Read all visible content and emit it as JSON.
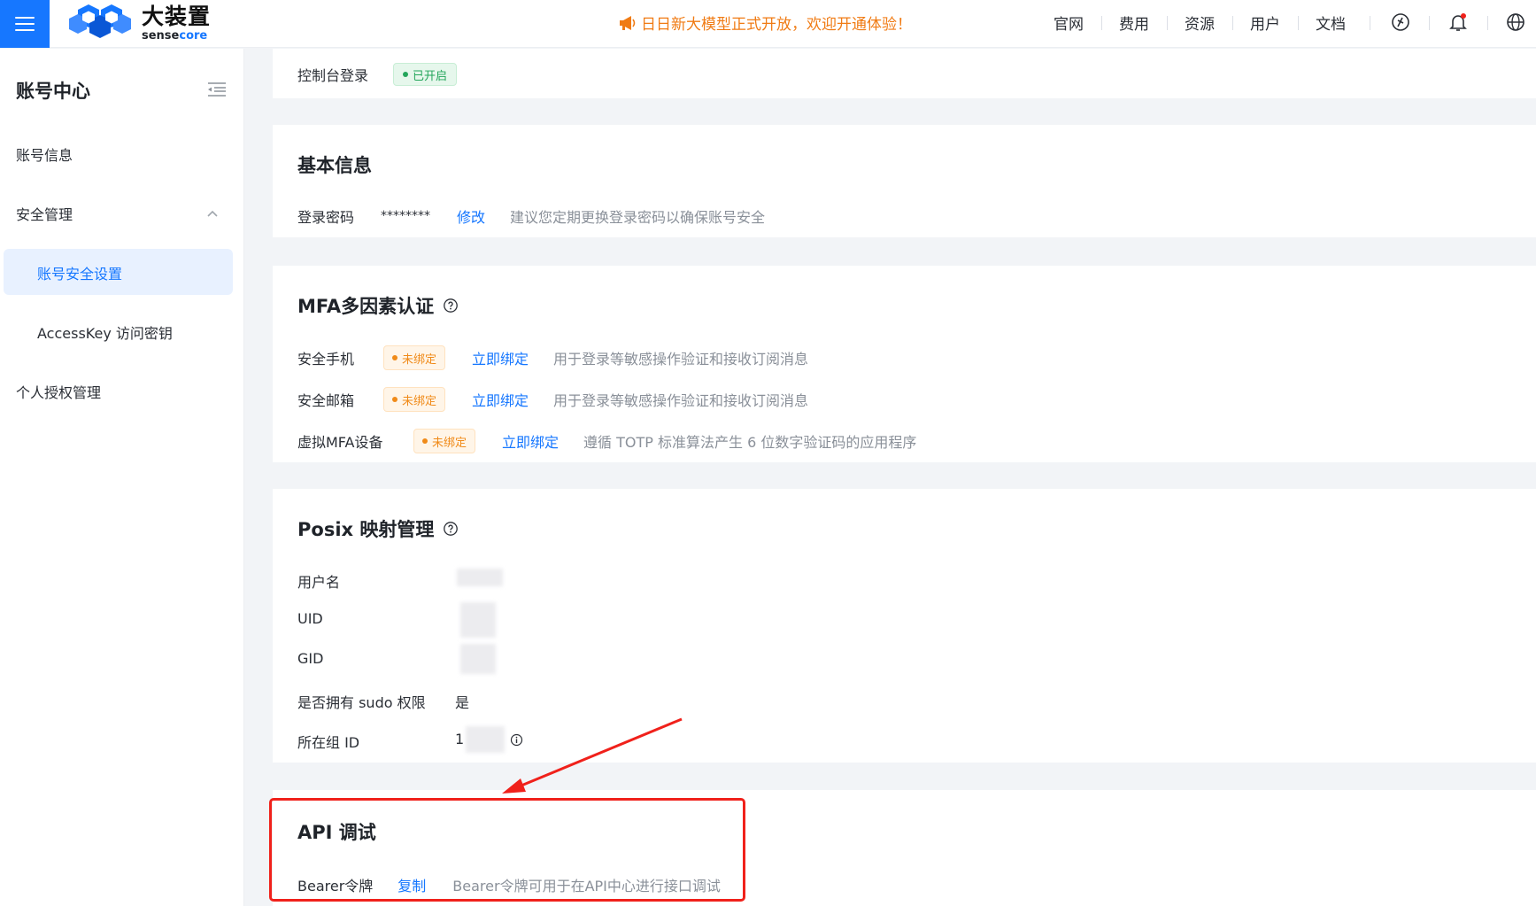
{
  "header": {
    "brand_cn": "大装置",
    "brand_en_prefix": "sense",
    "brand_en_suffix": "core",
    "announcement": "日日新大模型正式开放，欢迎开通体验！",
    "nav": [
      "官网",
      "费用",
      "资源",
      "用户",
      "文档"
    ],
    "icons": [
      "menu-icon",
      "megaphone-icon",
      "ai-assistant-icon",
      "bell-icon",
      "globe-icon"
    ],
    "accent": "#1677ff",
    "announcement_color": "#f07b14"
  },
  "sidebar": {
    "title": "账号中心",
    "items": [
      {
        "label": "账号信息"
      },
      {
        "label": "安全管理",
        "expanded": true
      },
      {
        "label": "账号安全设置",
        "active": true
      },
      {
        "label": "AccessKey 访问密钥"
      },
      {
        "label": "个人授权管理"
      }
    ]
  },
  "login_card": {
    "label": "控制台登录",
    "status": "已开启",
    "status_color": "#23a55a"
  },
  "basic_info": {
    "title": "基本信息",
    "password_label": "登录密码",
    "password_value": "********",
    "edit_link": "修改",
    "hint": "建议您定期更换登录密码以确保账号安全"
  },
  "mfa": {
    "title": "MFA多因素认证",
    "rows": [
      {
        "label": "安全手机",
        "status": "未绑定",
        "action": "立即绑定",
        "desc": "用于登录等敏感操作验证和接收订阅消息"
      },
      {
        "label": "安全邮箱",
        "status": "未绑定",
        "action": "立即绑定",
        "desc": "用于登录等敏感操作验证和接收订阅消息"
      },
      {
        "label": "虚拟MFA设备",
        "status": "未绑定",
        "action": "立即绑定",
        "desc": "遵循 TOTP 标准算法产生 6 位数字验证码的应用程序"
      }
    ],
    "status_color": "#f08a18"
  },
  "posix": {
    "title": "Posix 映射管理",
    "rows": [
      {
        "label": "用户名",
        "value": ""
      },
      {
        "label": "UID",
        "value": ""
      },
      {
        "label": "GID",
        "value": ""
      },
      {
        "label": "是否拥有 sudo 权限",
        "value": "是"
      },
      {
        "label": "所在组 ID",
        "value": "1"
      }
    ]
  },
  "api": {
    "title": "API 调试",
    "token_label": "Bearer令牌",
    "copy_link": "复制",
    "desc": "Bearer令牌可用于在API中心进行接口调试",
    "highlight_color": "#f0211b"
  }
}
